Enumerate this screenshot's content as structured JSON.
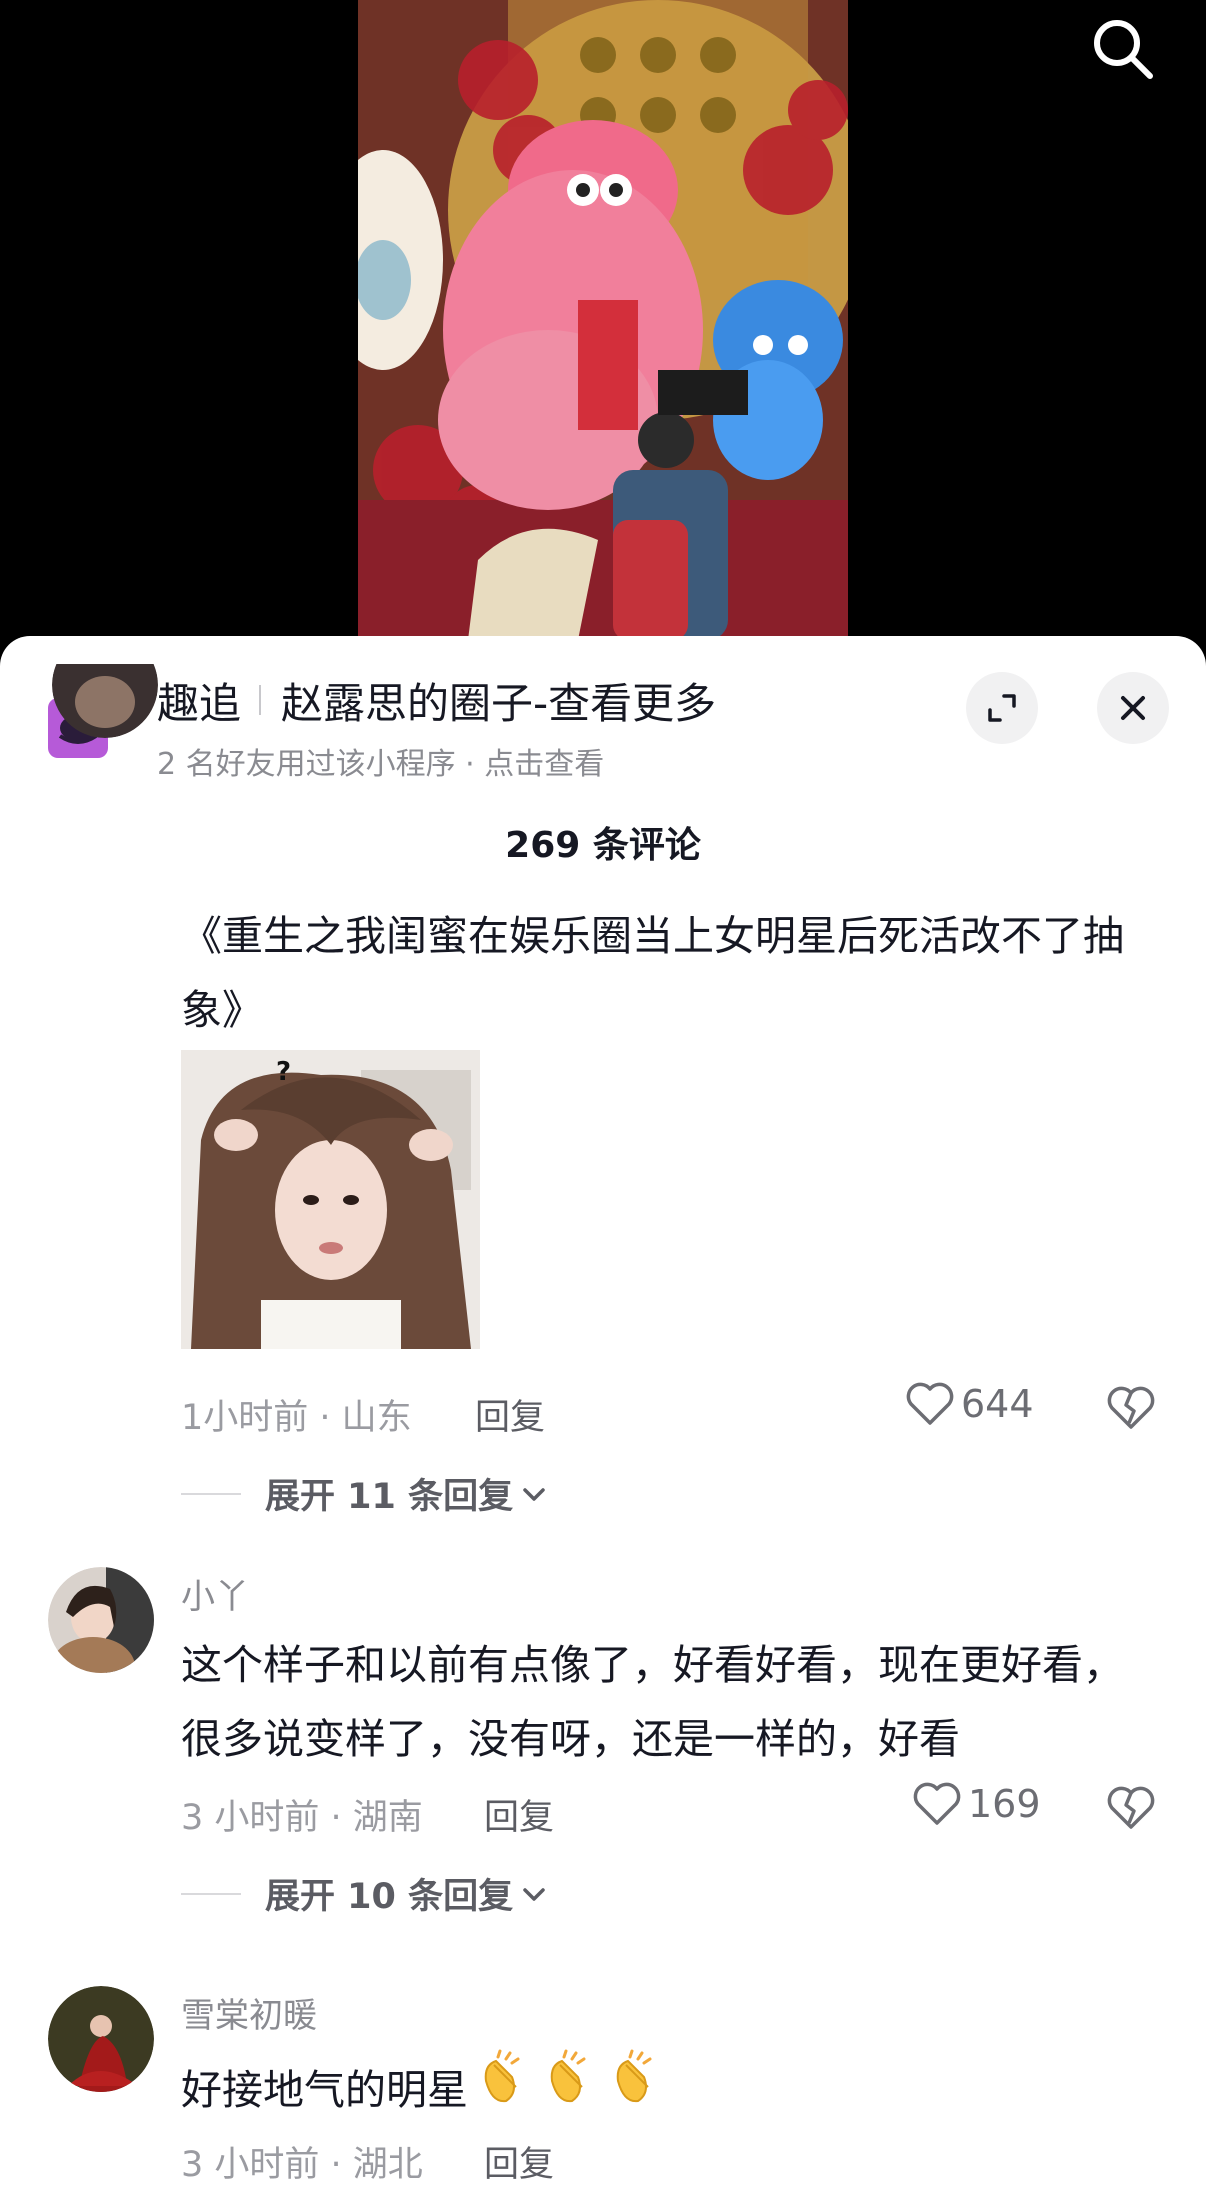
{
  "miniprogram": {
    "name": "趣追",
    "title": "赵露思的圈子-查看更多",
    "subtitle": "2 名好友用过该小程序 · 点击查看"
  },
  "comments_header": {
    "count_label": "269 条评论"
  },
  "comments": [
    {
      "username": "",
      "text": "《重生之我闺蜜在娱乐圈当上女明星后死活改不了抽象》",
      "time_location": "1小时前 · 山东",
      "reply_label": "回复",
      "likes": "644",
      "expand_label": "展开 11 条回复"
    },
    {
      "username": "小丫",
      "text": "这个样子和以前有点像了，好看好看，现在更好看，很多说变样了，没有呀，还是一样的，好看",
      "time_location": "3 小时前 · 湖南",
      "reply_label": "回复",
      "likes": "169",
      "expand_label": "展开 10 条回复"
    },
    {
      "username": "雪棠初暖",
      "text": "好接地气的明星",
      "time_location": "3 小时前 · 湖北",
      "reply_label": "回复"
    }
  ],
  "icons": {
    "search": "search-icon",
    "expand": "expand-icon",
    "close": "close-icon",
    "like": "heart-icon",
    "dislike": "broken-heart-icon",
    "chevron": "chevron-down-icon",
    "clap": "clapping-hands-emoji"
  },
  "colors": {
    "text_primary": "#161823",
    "text_secondary": "#8a8b91",
    "miniprogram_logo": "#b65ad8"
  }
}
